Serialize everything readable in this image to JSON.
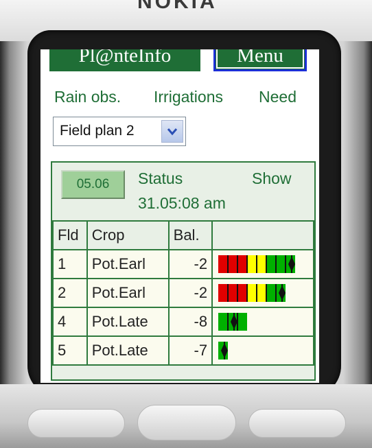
{
  "phone": {
    "brand": "NOKIA"
  },
  "header": {
    "left_button": "Pl@nteInfo",
    "right_button": "Menu"
  },
  "nav": {
    "rain": "Rain obs.",
    "irrigations": "Irrigations",
    "need": "Need"
  },
  "select": {
    "value": "Field plan 2"
  },
  "panel": {
    "date_button": "05.06",
    "status_label": "Status",
    "show_link": "Show",
    "timestamp": "31.05:08 am"
  },
  "table": {
    "headers": {
      "fld": "Fld",
      "crop": "Crop",
      "bal": "Bal.",
      "bar": ""
    },
    "rows": [
      {
        "fld": "1",
        "crop": "Pot.Earl",
        "bal": "-2",
        "bar": {
          "segments": [
            "red",
            "red",
            "red",
            "yellow",
            "yellow",
            "green",
            "green",
            "green"
          ],
          "marker": 8
        }
      },
      {
        "fld": "2",
        "crop": "Pot.Earl",
        "bal": "-2",
        "bar": {
          "segments": [
            "red",
            "red",
            "red",
            "yellow",
            "yellow",
            "green",
            "green"
          ],
          "marker": 7
        }
      },
      {
        "fld": "4",
        "crop": "Pot.Late",
        "bal": "-8",
        "bar": {
          "segments": [
            "green",
            "green",
            "green"
          ],
          "marker": 2
        }
      },
      {
        "fld": "5",
        "crop": "Pot.Late",
        "bal": "-7",
        "bar": {
          "segments": [
            "green"
          ],
          "marker": 1
        }
      }
    ]
  },
  "colors": {
    "green": "#00b000",
    "red": "#e00000",
    "yellow": "#ffff00",
    "dark_green": "#1f6e36",
    "link_blue": "#1c2fd6"
  }
}
